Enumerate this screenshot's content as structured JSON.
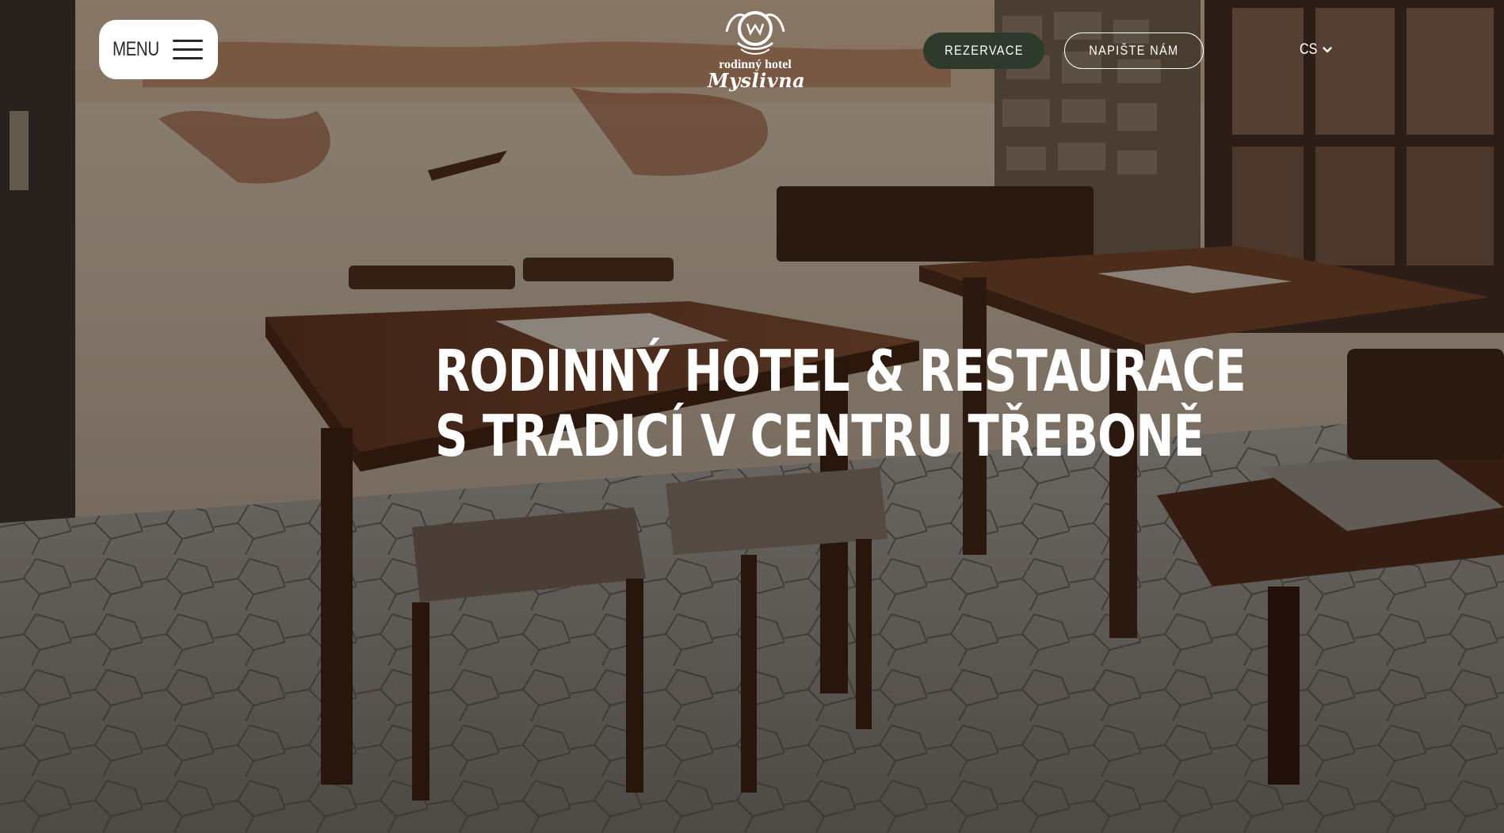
{
  "header": {
    "menu_label": "MENU",
    "logo": {
      "line1": "rodinný hotel",
      "line2": "Myslivna"
    },
    "reservation_label": "REZERVACE",
    "contact_label": "NAPIŠTE NÁM",
    "language": "CS"
  },
  "hero": {
    "headline_line1": "RODINNÝ HOTEL & RESTAURACE",
    "headline_line2": "S TRADICÍ V CENTRU TŘEBONĚ"
  },
  "colors": {
    "reservation_bg": "#2e3a2c",
    "text_light": "#ffffff",
    "menu_bg": "#ffffff"
  },
  "icons": [
    "hamburger-icon",
    "chevron-down-icon",
    "hunting-horn-emblem-icon"
  ]
}
